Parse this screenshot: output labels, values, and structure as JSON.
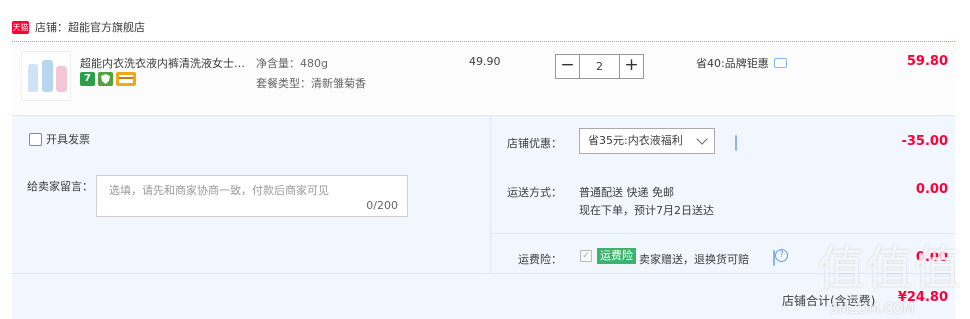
{
  "shop": {
    "badge": "天猫",
    "label": "店铺：超能官方旗舰店"
  },
  "item": {
    "title": "超能内衣洗衣液内裤清洗液女士…",
    "spec1": "净含量：480g",
    "spec2": "套餐类型：清新雏菊香",
    "unit_price": "49.90",
    "qty_minus": "−",
    "qty": "2",
    "qty_plus": "+",
    "discount": "省40:品牌钜惠",
    "subtotal": "59.80",
    "badge_7": "7"
  },
  "options": {
    "invoice_label": "开具发票",
    "message_label": "给卖家留言：",
    "message_placeholder": "选填，请先和商家协商一致，付款后商家可见",
    "message_count": "0/200",
    "shop_discount_label": "店铺优惠：",
    "shop_discount_selected": "省35元:内衣液福利",
    "shop_discount_value": "-35.00",
    "shipping_label": "运送方式：",
    "shipping_method": "普通配送 快递 免邮",
    "shipping_eta": "现在下单，预计7月2日送达",
    "shipping_value": "0.00",
    "insurance_label": "运费险：",
    "insurance_badge": "运费险",
    "insurance_text": "卖家赠送，退换货可赔",
    "insurance_value": "0.00",
    "help_glyph": "?",
    "check_glyph": "✓"
  },
  "total": {
    "label": "店铺合计(含运费)",
    "value": "¥24.80"
  },
  "watermark": {
    "text": "值值值",
    "sub": "SMZDM.COM"
  },
  "colors": {
    "price_red": "#ff0036",
    "panel_bg": "#f2f7ff",
    "badge_green": "#3cb36a"
  }
}
